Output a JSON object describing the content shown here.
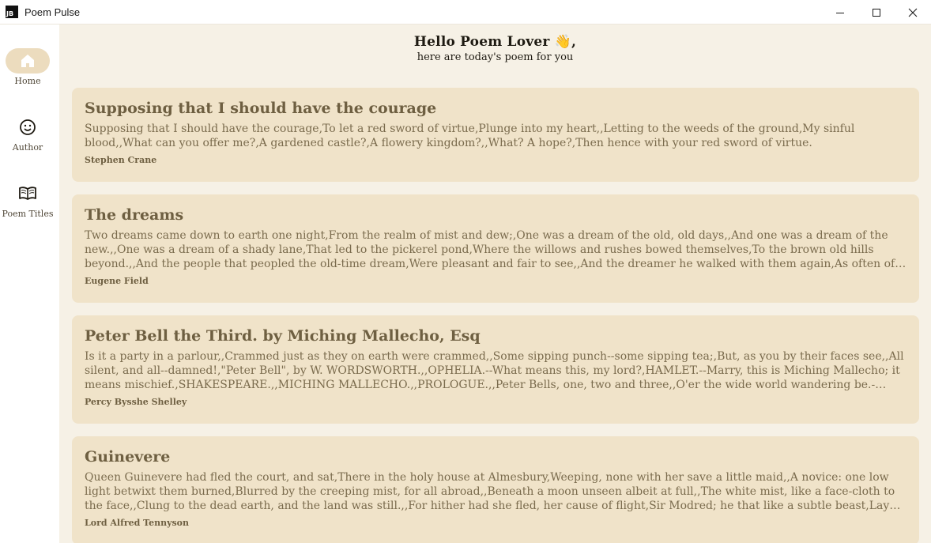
{
  "window": {
    "app_icon_text": "JB",
    "title": "Poem Pulse",
    "controls": [
      "minimize-icon",
      "maximize-icon",
      "close-icon"
    ]
  },
  "sidebar": {
    "items": [
      {
        "label": "Home",
        "icon": "home-icon",
        "active": true
      },
      {
        "label": "Author",
        "icon": "smiley-face-icon",
        "active": false
      },
      {
        "label": "Poem Titles",
        "icon": "open-book-icon",
        "active": false
      }
    ]
  },
  "greeting": {
    "title": "Hello Poem Lover 👋,",
    "subtitle": "here are today's poem for you"
  },
  "poems": [
    {
      "title": "Supposing that I should have the courage",
      "text": "Supposing that I should have the courage,To let a red sword of virtue,Plunge into my heart,,Letting to the weeds of the ground,My sinful blood,,What can you offer me?,A gardened castle?,A flowery kingdom?,,What? A hope?,Then hence with your red sword of virtue.",
      "author": "Stephen Crane"
    },
    {
      "title": "The dreams",
      "text": "Two dreams came down to earth one night,From the realm of mist and dew;,One was a dream of the old, old days,,And one was a dream of the new.,,One was a dream of a shady lane,That led to the pickerel pond,Where the willows and rushes bowed themselves,To the brown old hills beyond.,,And the people that peopled the old-time dream,Were pleasant and fair to see,,And the dreamer he walked with them again,As often of old walked he.",
      "author": "Eugene Field"
    },
    {
      "title": "Peter Bell the Third.  by Miching Mallecho, Esq",
      "text": "Is it a party in a parlour,,Crammed just as they on earth were crammed,,Some sipping punch--some sipping tea;,But, as you by their faces see,,All silent, and all--damned!,\"Peter Bell\", by W. WORDSWORTH.,,OPHELIA.--What means this, my lord?,HAMLET.--Marry, this is Miching Mallecho; it means mischief.,SHAKESPEARE.,,MICHING MALLECHO.,,PROLOGUE.,,Peter Bells, one, two and three,,O'er the wide world wandering be.--,First, the antenatal Peter,",
      "author": "Percy Bysshe Shelley"
    },
    {
      "title": "Guinevere",
      "text": "Queen Guinevere had fled the court, and sat,There in the holy house at Almesbury,Weeping, none with her save a little maid,,A novice: one low light betwixt them burned,Blurred by the creeping mist, for all abroad,,Beneath a moon unseen albeit at full,,The white mist, like a face-cloth to the face,,Clung to the dead earth, and the land was still.,,For hither had she fled, her cause of flight,Sir Modred; he that like a subtle beast,Lay couchant with his eyes upon the throne,",
      "author": "Lord Alfred Tennyson"
    }
  ]
}
